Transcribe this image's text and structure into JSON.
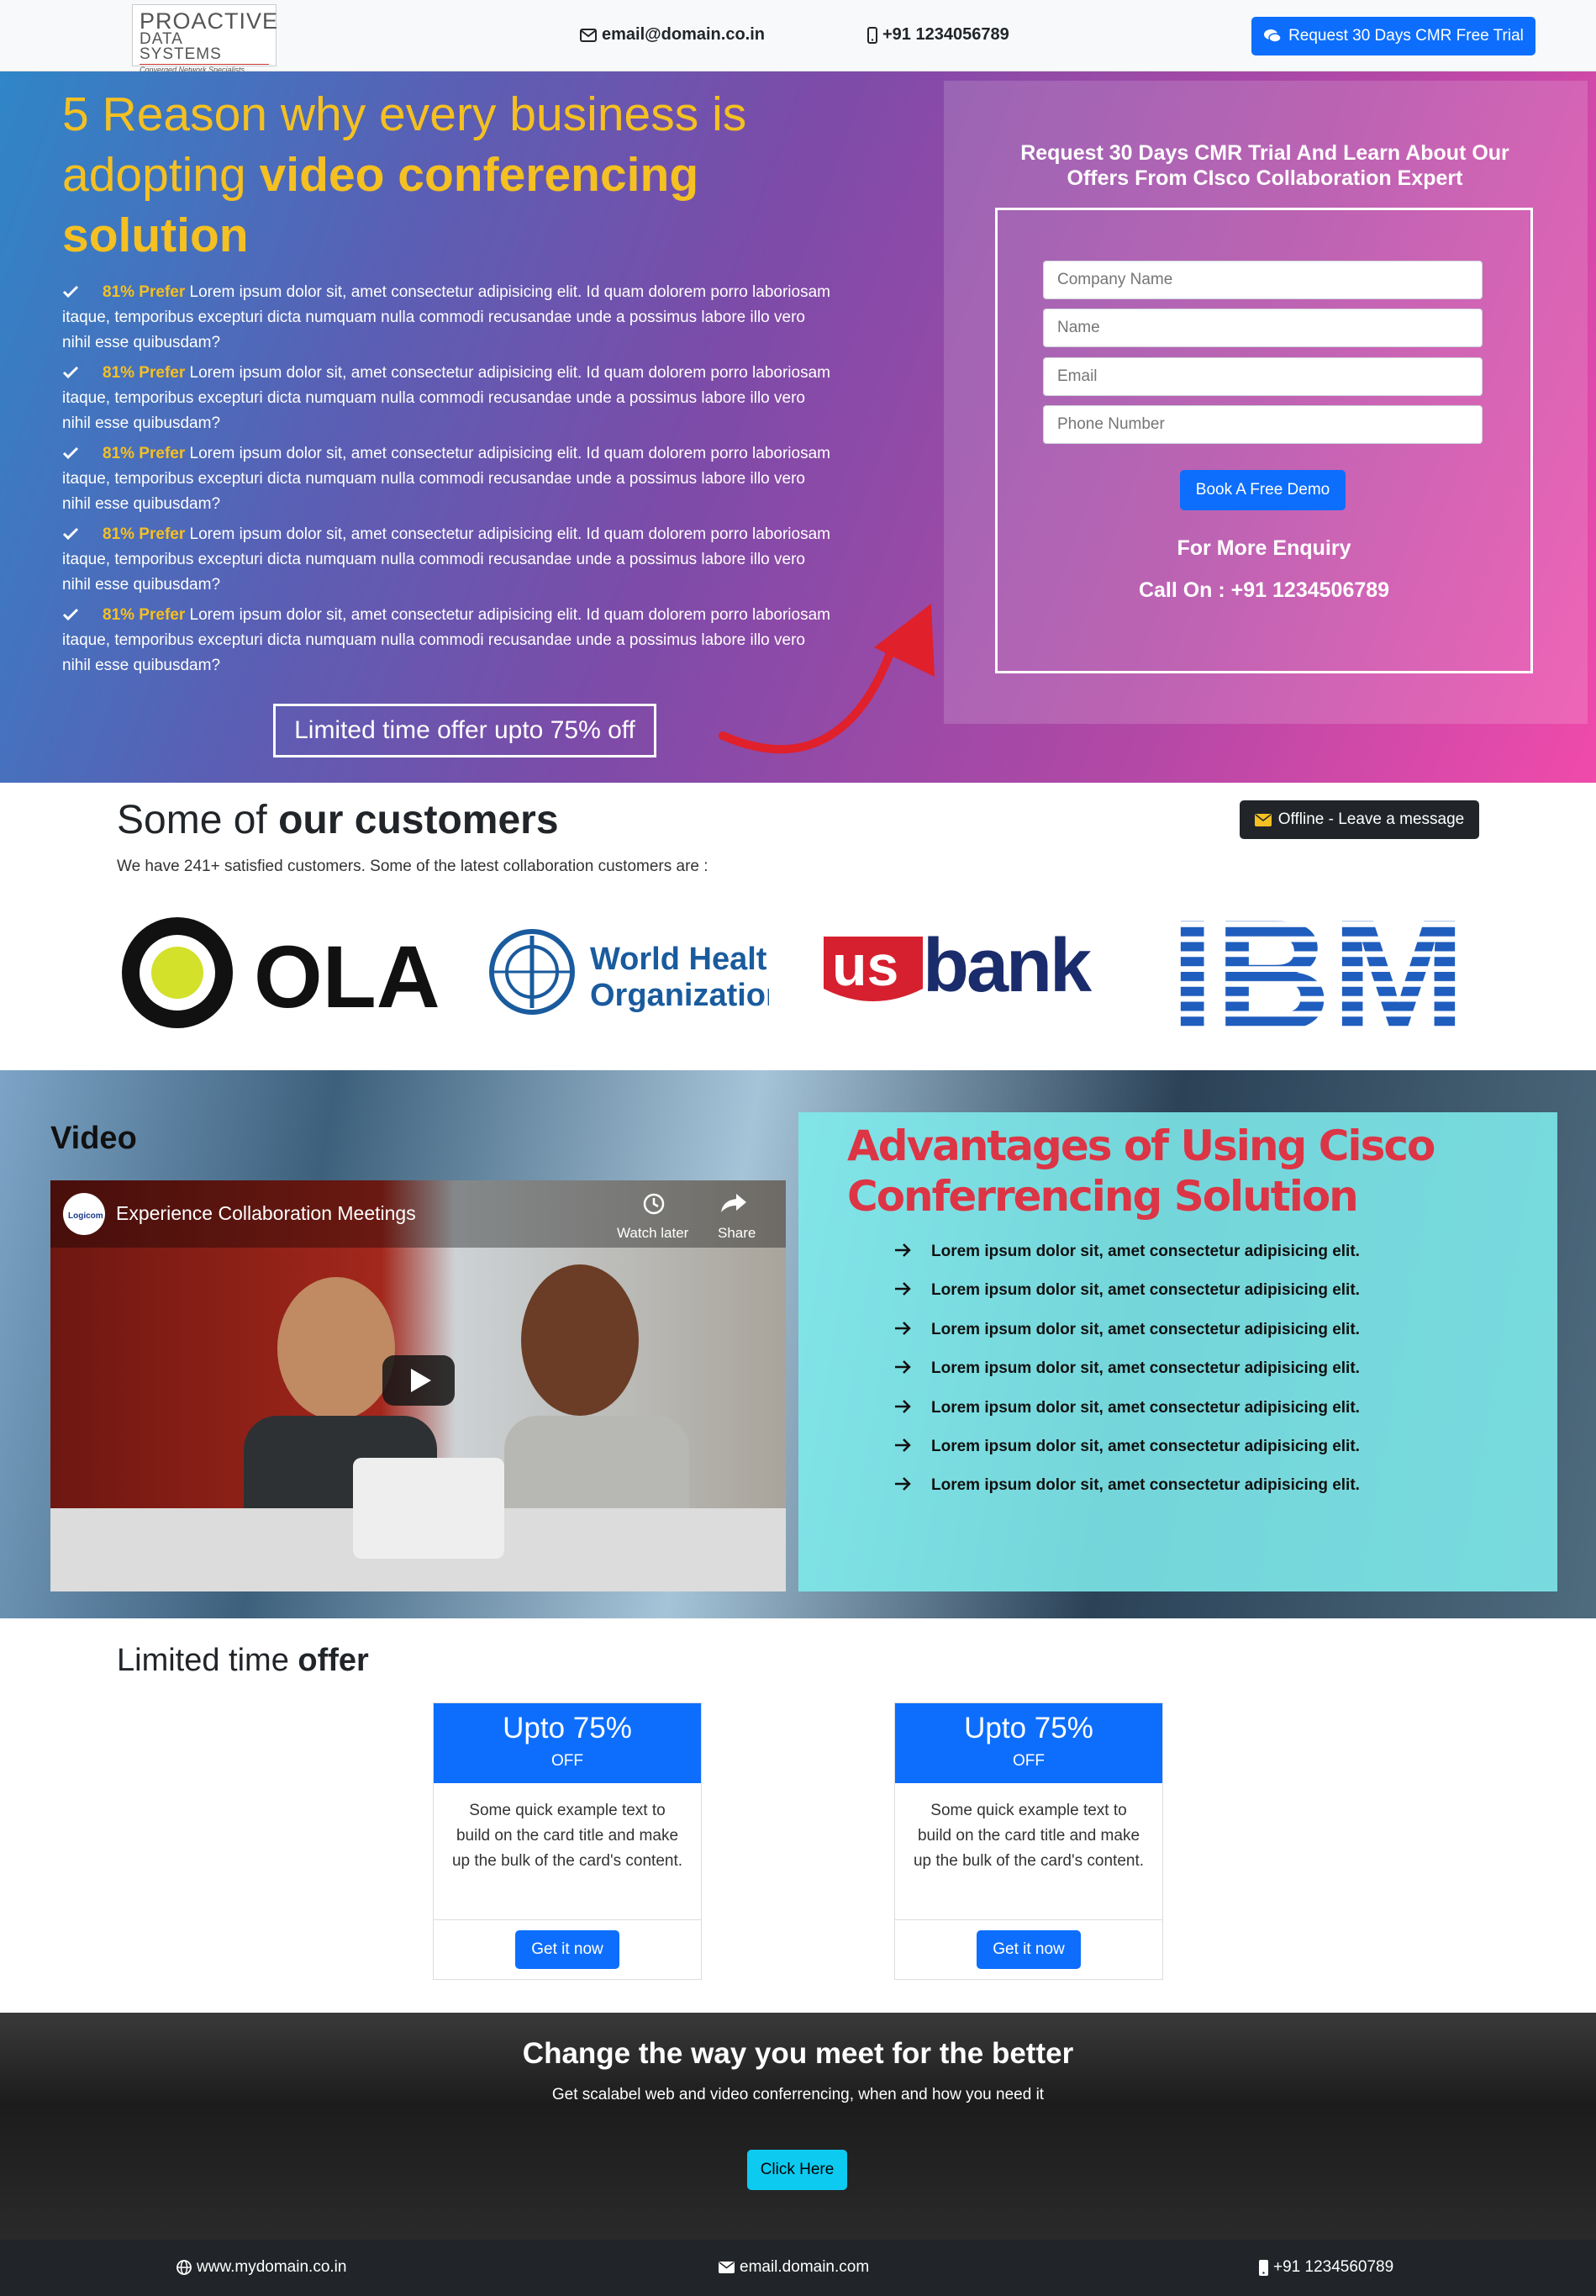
{
  "header": {
    "logo": {
      "line1": "PROACTIVE",
      "line2": "DATA SYSTEMS",
      "tagline": "Converged Network Specialists"
    },
    "email": "email@domain.co.in",
    "phone": "+91 1234056789",
    "trial_button": "Request 30 Days CMR Free Trial"
  },
  "hero": {
    "title_part1": "5 Reason",
    "title_part2": " why every business is adopting ",
    "title_part3": "video conferencing solution",
    "list": [
      {
        "highlight": "81% Prefer",
        "text": " Lorem ipsum dolor sit, amet consectetur adipisicing elit. Id quam dolorem porro laboriosam itaque, temporibus excepturi dicta numquam nulla commodi recusandae unde a possimus labore illo vero nihil esse quibusdam?"
      },
      {
        "highlight": "81% Prefer",
        "text": " Lorem ipsum dolor sit, amet consectetur adipisicing elit. Id quam dolorem porro laboriosam itaque, temporibus excepturi dicta numquam nulla commodi recusandae unde a possimus labore illo vero nihil esse quibusdam?"
      },
      {
        "highlight": "81% Prefer",
        "text": " Lorem ipsum dolor sit, amet consectetur adipisicing elit. Id quam dolorem porro laboriosam itaque, temporibus excepturi dicta numquam nulla commodi recusandae unde a possimus labore illo vero nihil esse quibusdam?"
      },
      {
        "highlight": "81% Prefer",
        "text": " Lorem ipsum dolor sit, amet consectetur adipisicing elit. Id quam dolorem porro laboriosam itaque, temporibus excepturi dicta numquam nulla commodi recusandae unde a possimus labore illo vero nihil esse quibusdam?"
      },
      {
        "highlight": "81% Prefer",
        "text": " Lorem ipsum dolor sit, amet consectetur adipisicing elit. Id quam dolorem porro laboriosam itaque, temporibus excepturi dicta numquam nulla commodi recusandae unde a possimus labore illo vero nihil esse quibusdam?"
      }
    ],
    "offer_box": "Limited time offer upto 75% off"
  },
  "form": {
    "heading": "Request 30 Days CMR Trial And Learn About Our Offers From CIsco Collaboration Expert",
    "placeholders": {
      "company": "Company Name",
      "name": "Name",
      "email": "Email",
      "phone": "Phone Number"
    },
    "submit": "Book A Free Demo",
    "enquiry": "For More Enquiry",
    "call": "Call On : +91 1234506789"
  },
  "customers": {
    "title_light": "Some of ",
    "title_bold": "our customers",
    "subtitle": "We have 241+ satisfied customers. Some of the latest collaboration customers are :",
    "offline_button": "Offline - Leave a message",
    "logos": {
      "ola": "OLA",
      "who_line1": "World Health",
      "who_line2": "Organization",
      "us": "us",
      "bank": "bank",
      "ibm": "IBM"
    }
  },
  "video_section": {
    "title": "Video",
    "video_caption": "Experience Collaboration Meetings",
    "channel": "Logicom",
    "watch_later": "Watch later",
    "share": "Share",
    "adv_title": "Advantages of Using Cisco Conferrencing Solution",
    "adv_items": [
      "Lorem ipsum dolor sit, amet consectetur adipisicing elit.",
      "Lorem ipsum dolor sit, amet consectetur adipisicing elit.",
      "Lorem ipsum dolor sit, amet consectetur adipisicing elit.",
      "Lorem ipsum dolor sit, amet consectetur adipisicing elit.",
      "Lorem ipsum dolor sit, amet consectetur adipisicing elit.",
      "Lorem ipsum dolor sit, amet consectetur adipisicing elit.",
      "Lorem ipsum dolor sit, amet consectetur adipisicing elit."
    ]
  },
  "limited": {
    "title_light": "Limited time ",
    "title_bold": "offer",
    "cards": [
      {
        "title": "Upto 75%",
        "sub": "OFF",
        "body": "Some quick example text to build on the card title and make up the bulk of the card's content.",
        "button": "Get it now"
      },
      {
        "title": "Upto 75%",
        "sub": "OFF",
        "body": "Some quick example text to build on the card title and make up the bulk of the card's content.",
        "button": "Get it now"
      }
    ]
  },
  "cta": {
    "title": "Change the way you meet for the better",
    "subtitle": "Get scalabel web and video conferrencing, when and how you need it",
    "button": "Click Here"
  },
  "footer": {
    "website": "www.mydomain.co.in",
    "email": "email.domain.com",
    "phone": "+91 1234560789"
  },
  "colors": {
    "primary": "#0d6efd",
    "accent_yellow": "#f4c022",
    "advantage_red": "#dc3545",
    "info": "#0dcaf0"
  },
  "icons": [
    "envelope-icon",
    "mobile-icon",
    "chat-icon",
    "check-icon",
    "arrow-right-icon",
    "globe-icon",
    "clock-icon",
    "share-icon",
    "play-icon"
  ]
}
